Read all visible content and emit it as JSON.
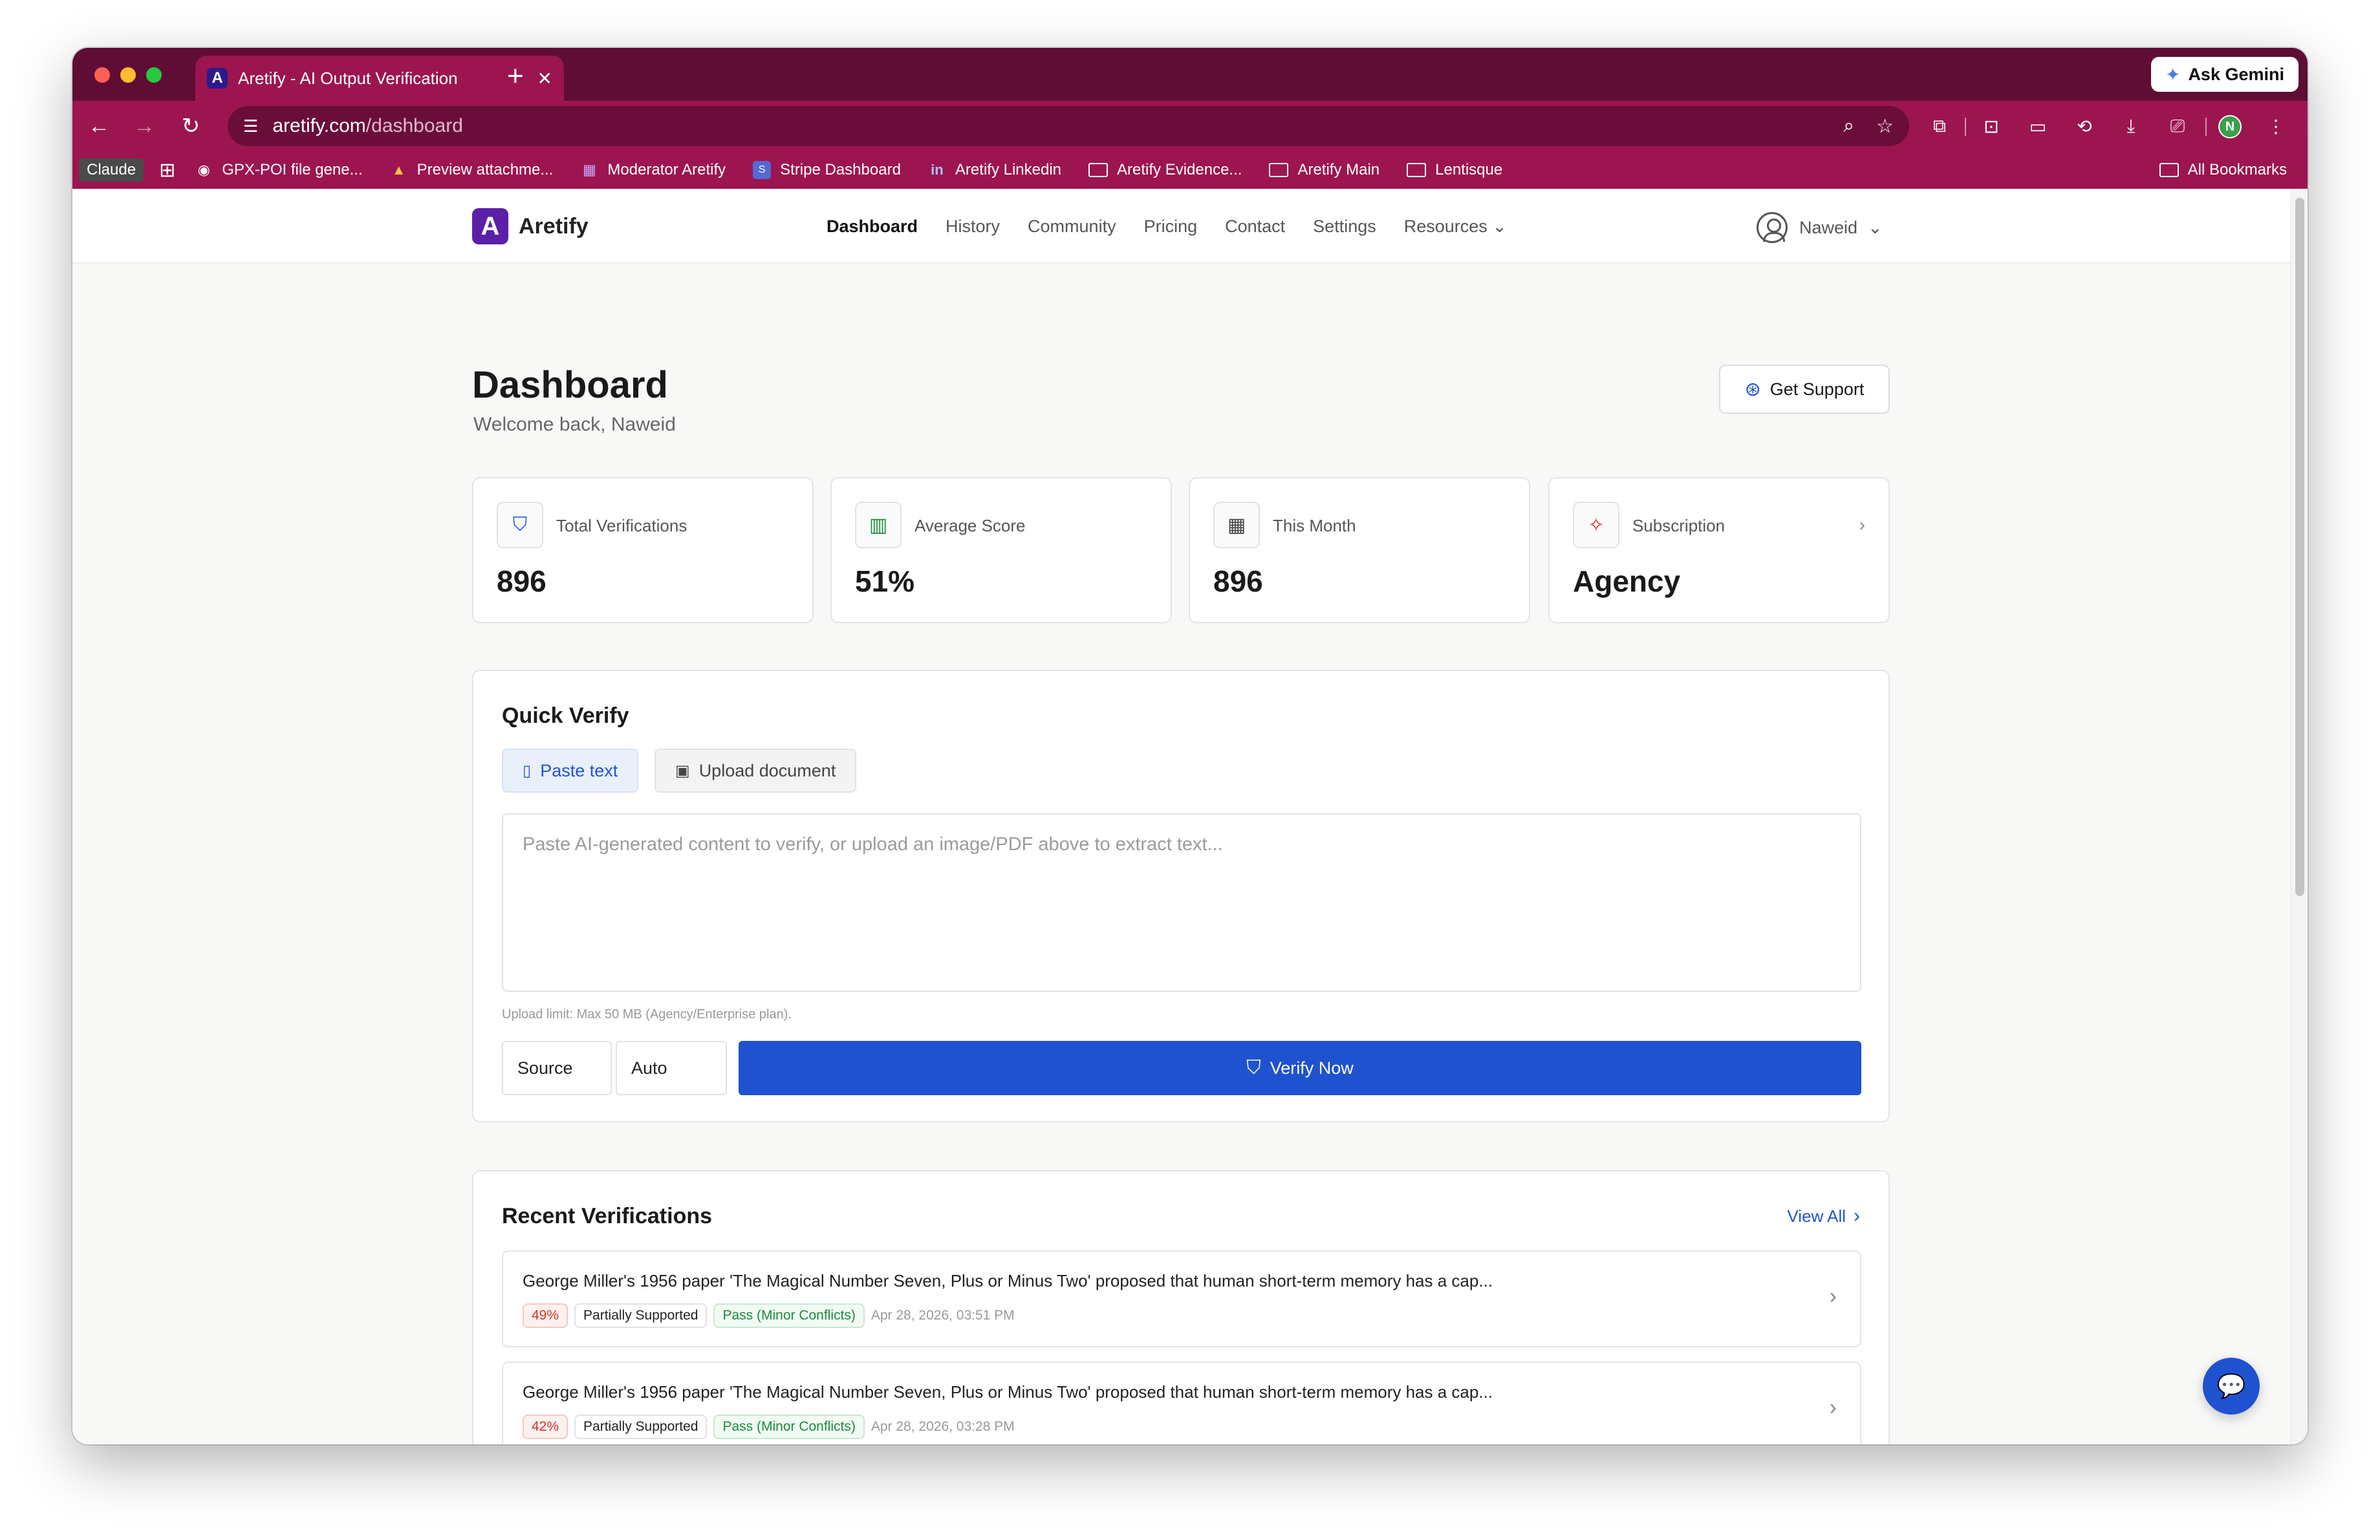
{
  "browser": {
    "tab_title": "Aretify - AI Output Verification",
    "tab_favicon": "A",
    "new_tab_label": "+",
    "gemini_label": "Ask Gemini",
    "url_host": "aretify.com",
    "url_path": "/dashboard",
    "profile_initial": "N",
    "bookmarks": [
      {
        "label": "Claude",
        "icon": "claude-chip"
      },
      {
        "label": "GPX-POI file gene...",
        "icon": "globe-icon"
      },
      {
        "label": "Preview attachme...",
        "icon": "drive-icon"
      },
      {
        "label": "Moderator Aretify",
        "icon": "image-icon"
      },
      {
        "label": "Stripe Dashboard",
        "icon": "stripe-icon"
      },
      {
        "label": "Aretify Linkedin",
        "icon": "linkedin-icon"
      },
      {
        "label": "Aretify Evidence...",
        "icon": "folder-icon"
      },
      {
        "label": "Aretify Main",
        "icon": "folder-icon"
      },
      {
        "label": "Lentisque",
        "icon": "folder-icon"
      }
    ],
    "all_bookmarks_label": "All Bookmarks"
  },
  "nav": {
    "brand": "Aretify",
    "logo_letter": "A",
    "items": [
      {
        "label": "Dashboard",
        "active": true
      },
      {
        "label": "History"
      },
      {
        "label": "Community"
      },
      {
        "label": "Pricing"
      },
      {
        "label": "Contact"
      },
      {
        "label": "Settings"
      },
      {
        "label": "Resources"
      }
    ],
    "user_name": "Naweid"
  },
  "header": {
    "title": "Dashboard",
    "welcome": "Welcome back, Naweid",
    "support_label": "Get Support"
  },
  "stats": [
    {
      "label": "Total Verifications",
      "value": "896",
      "icon": "shield-check-icon"
    },
    {
      "label": "Average Score",
      "value": "51%",
      "icon": "bar-chart-icon"
    },
    {
      "label": "This Month",
      "value": "896",
      "icon": "calendar-icon"
    },
    {
      "label": "Subscription",
      "value": "Agency",
      "icon": "sparkle-icon"
    }
  ],
  "quick_verify": {
    "title": "Quick Verify",
    "tab_paste": "Paste text",
    "tab_upload": "Upload document",
    "placeholder": "Paste AI-generated content to verify, or upload an image/PDF above to extract text...",
    "upload_limit": "Upload limit: Max 50 MB (Agency/Enterprise plan).",
    "source_label": "Source",
    "source_value": "Auto",
    "verify_label": "Verify Now"
  },
  "recent": {
    "title": "Recent Verifications",
    "view_all": "View All",
    "rows": [
      {
        "text": "George Miller's 1956 paper 'The Magical Number Seven, Plus or Minus Two' proposed that human short-term memory has a cap...",
        "score": "49%",
        "status": "Partially Supported",
        "result": "Pass (Minor Conflicts)",
        "date": "Apr 28, 2026, 03:51 PM"
      },
      {
        "text": "George Miller's 1956 paper 'The Magical Number Seven, Plus or Minus Two' proposed that human short-term memory has a cap...",
        "score": "42%",
        "status": "Partially Supported",
        "result": "Pass (Minor Conflicts)",
        "date": "Apr 28, 2026, 03:28 PM"
      }
    ]
  },
  "colors": {
    "chrome_dark": "#5f0d35",
    "chrome": "#9c1550",
    "accent": "#1f52d0",
    "brand": "#5b1fa8"
  }
}
